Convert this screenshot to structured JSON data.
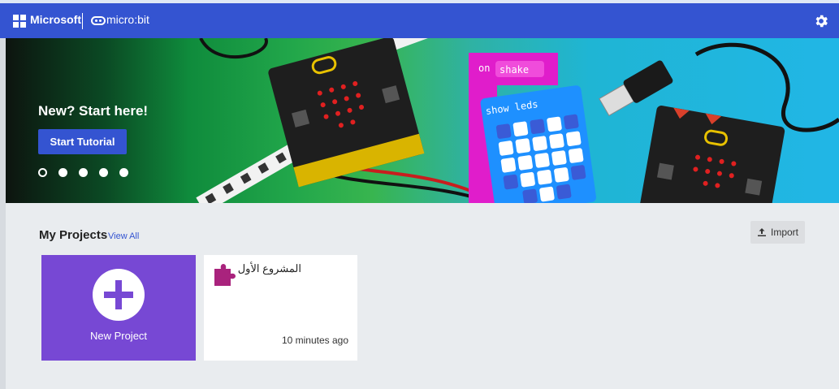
{
  "header": {
    "brand": "Microsoft",
    "product": "micro:bit",
    "settings_icon": "gear-icon"
  },
  "hero": {
    "title": "New? Start here!",
    "button_label": "Start Tutorial",
    "slide_count": 5,
    "active_slide": 1,
    "blocks": {
      "event_label": "on",
      "event_value": "shake",
      "action_label": "show leds"
    }
  },
  "projects": {
    "title": "My Projects",
    "view_all": "View All",
    "import_label": "Import",
    "new_project_label": "New Project",
    "items": [
      {
        "name": "المشروع الأول",
        "time": "10 minutes ago",
        "icon": "puzzle-icon"
      }
    ]
  },
  "colors": {
    "header": "#3454d1",
    "new_card": "#7748d4",
    "puzzle": "#a9237d"
  }
}
